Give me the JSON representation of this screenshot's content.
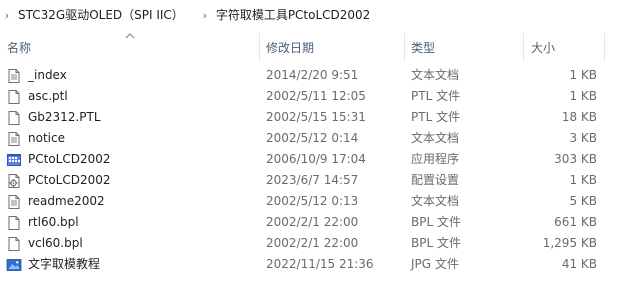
{
  "breadcrumb": {
    "items": [
      {
        "label": "STC32G驱动OLED（SPI IIC）"
      },
      {
        "label": "字符取模工具PCtoLCD2002"
      }
    ]
  },
  "columns": {
    "name": "名称",
    "date": "修改日期",
    "type": "类型",
    "size": "大小"
  },
  "files": [
    {
      "name": "_index",
      "date": "2014/2/20 9:51",
      "type": "文本文档",
      "size": "1 KB",
      "icon": "text-document-icon"
    },
    {
      "name": "asc.ptl",
      "date": "2002/5/11 12:05",
      "type": "PTL 文件",
      "size": "1 KB",
      "icon": "blank-file-icon"
    },
    {
      "name": "Gb2312.PTL",
      "date": "2002/5/15 15:31",
      "type": "PTL 文件",
      "size": "18 KB",
      "icon": "blank-file-icon"
    },
    {
      "name": "notice",
      "date": "2002/5/12 0:14",
      "type": "文本文档",
      "size": "3 KB",
      "icon": "text-document-icon"
    },
    {
      "name": "PCtoLCD2002",
      "date": "2006/10/9 17:04",
      "type": "应用程序",
      "size": "303 KB",
      "icon": "application-icon"
    },
    {
      "name": "PCtoLCD2002",
      "date": "2023/6/7 14:57",
      "type": "配置设置",
      "size": "1 KB",
      "icon": "config-settings-icon"
    },
    {
      "name": "readme2002",
      "date": "2002/5/12 0:13",
      "type": "文本文档",
      "size": "5 KB",
      "icon": "text-document-icon"
    },
    {
      "name": "rtl60.bpl",
      "date": "2002/2/1 22:00",
      "type": "BPL 文件",
      "size": "661 KB",
      "icon": "blank-file-icon"
    },
    {
      "name": "vcl60.bpl",
      "date": "2002/2/1 22:00",
      "type": "BPL 文件",
      "size": "1,295 KB",
      "icon": "blank-file-icon"
    },
    {
      "name": "文字取模教程",
      "date": "2022/11/15 21:36",
      "type": "JPG 文件",
      "size": "41 KB",
      "icon": "image-file-icon"
    }
  ]
}
